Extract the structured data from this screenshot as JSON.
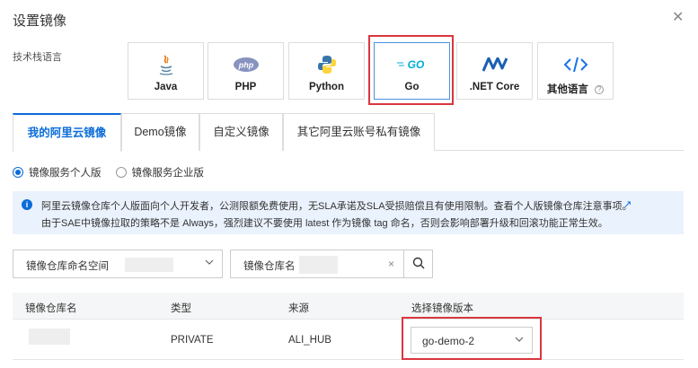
{
  "dialog": {
    "title": "设置镜像",
    "close_icon": "close-icon"
  },
  "tech_stack": {
    "label": "技术栈语言",
    "options": [
      {
        "name": "Java",
        "icon": "java-icon"
      },
      {
        "name": "PHP",
        "icon": "php-icon"
      },
      {
        "name": "Python",
        "icon": "python-icon"
      },
      {
        "name": "Go",
        "icon": "go-icon",
        "selected": true
      },
      {
        "name": ".NET Core",
        "icon": "dotnet-icon"
      },
      {
        "name": "其他语言",
        "icon": "code-icon"
      }
    ],
    "help_icon": "?"
  },
  "tabs": [
    {
      "label": "我的阿里云镜像",
      "active": true
    },
    {
      "label": "Demo镜像"
    },
    {
      "label": "自定义镜像"
    },
    {
      "label": "其它阿里云账号私有镜像"
    }
  ],
  "edition": {
    "options": [
      {
        "label": "镜像服务个人版",
        "checked": true
      },
      {
        "label": "镜像服务企业版",
        "checked": false
      }
    ]
  },
  "notice": {
    "line1": "阿里云镜像仓库个人版面向个人开发者，公测限额免费使用，无SLA承诺及SLA受损赔偿且有使用限制。查看个人版镜像仓库注意事项。",
    "line2": "由于SAE中镜像拉取的策略不是 Always，强烈建议不要使用 latest 作为镜像 tag 命名，否则会影响部署升级和回滚功能正常生效。",
    "info_glyph": "i",
    "link_icon": "↗"
  },
  "filters": {
    "namespace_label": "镜像仓库命名空间",
    "repo_name_label": "镜像仓库名",
    "clear_glyph": "×"
  },
  "table": {
    "columns": [
      "镜像仓库名",
      "类型",
      "来源",
      "选择镜像版本"
    ],
    "rows": [
      {
        "type": "PRIVATE",
        "source": "ALI_HUB",
        "version": "go-demo-2"
      }
    ]
  },
  "colors": {
    "accent": "#0a6cd9",
    "highlight": "#d9363e"
  }
}
